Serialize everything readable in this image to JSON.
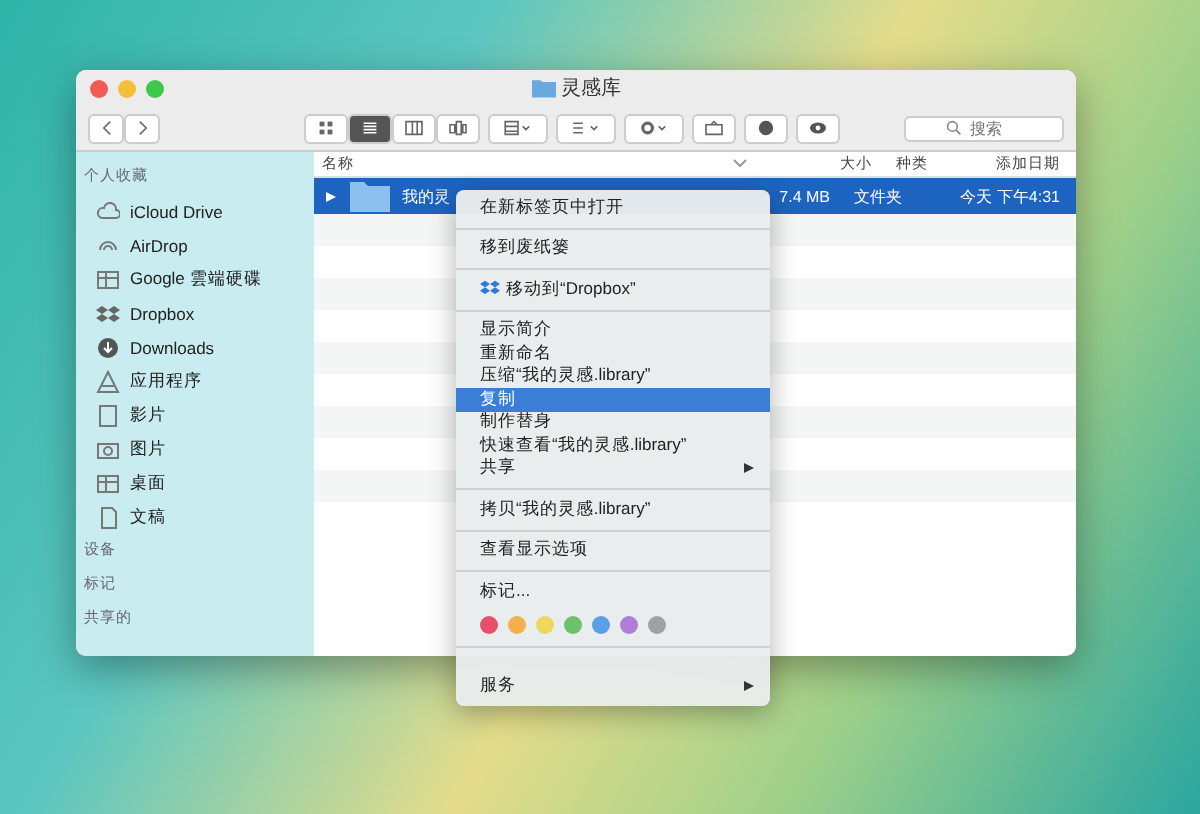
{
  "window": {
    "title": "灵感库"
  },
  "search": {
    "placeholder": "搜索"
  },
  "sidebar": {
    "sections": [
      {
        "title": "个人收藏",
        "items": [
          {
            "label": "iCloud Drive",
            "kind": "cloud"
          },
          {
            "label": "AirDrop",
            "kind": "airdrop"
          },
          {
            "label": "Google 雲端硬碟",
            "kind": "grid"
          },
          {
            "label": "Dropbox",
            "kind": "dropbox"
          },
          {
            "label": "Downloads",
            "kind": "download"
          },
          {
            "label": "应用程序",
            "kind": "apps"
          },
          {
            "label": "影片",
            "kind": "film"
          },
          {
            "label": "图片",
            "kind": "photo"
          },
          {
            "label": "桌面",
            "kind": "grid"
          },
          {
            "label": "文稿",
            "kind": "doc"
          }
        ]
      },
      {
        "title": "设备"
      },
      {
        "title": "标记"
      },
      {
        "title": "共享的"
      }
    ]
  },
  "table": {
    "columns": [
      "名称",
      "大小",
      "种类",
      "添加日期"
    ],
    "rows": [
      {
        "name": "我的灵",
        "size": "7.4 MB",
        "kind": "文件夹",
        "date": "今天 下午4:31",
        "selected": true
      }
    ]
  },
  "context_menu": {
    "groups": [
      [
        {
          "label": "在新标签页中打开",
          "selected": false,
          "submenu": false
        }
      ],
      [
        {
          "label": "移到废纸篓",
          "selected": false,
          "submenu": false
        }
      ],
      [
        {
          "label": "移动到“Dropbox”",
          "selected": false,
          "submenu": false
        }
      ],
      [
        {
          "label": "显示简介",
          "selected": false,
          "submenu": false
        },
        {
          "label": "重新命名",
          "selected": false,
          "submenu": false
        },
        {
          "label": "压缩“我的灵感.library”",
          "selected": false,
          "submenu": false
        },
        {
          "label": "复制",
          "selected": true,
          "submenu": false
        },
        {
          "label": "制作替身",
          "selected": false,
          "submenu": false
        },
        {
          "label": "快速查看“我的灵感.library”",
          "selected": false,
          "submenu": false
        },
        {
          "label": "共享",
          "selected": false,
          "submenu": true
        }
      ],
      [
        {
          "label": "拷贝“我的灵感.library”",
          "selected": false,
          "submenu": false
        }
      ],
      [
        {
          "label": "查看显示选项",
          "selected": false,
          "submenu": false
        }
      ],
      [
        {
          "label": "标记...",
          "selected": false,
          "submenu": false
        }
      ]
    ],
    "tag_colors": [
      {
        "color": "#e8506a"
      },
      {
        "color": "#f2b04e"
      },
      {
        "color": "#ecd85a"
      },
      {
        "color": "#6cc16a"
      },
      {
        "color": "#5aa0e6"
      },
      {
        "color": "#b07ed8"
      },
      {
        "color": "#a0a0a8"
      }
    ],
    "services": {
      "label": "服务",
      "submenu": true
    }
  }
}
